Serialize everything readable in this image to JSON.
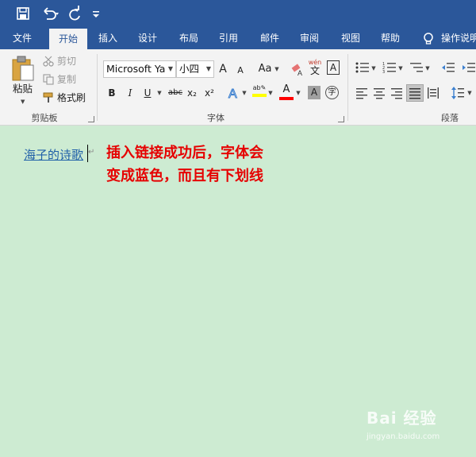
{
  "quick_access": {
    "save_icon": "save-icon",
    "undo_icon": "undo-icon",
    "redo_icon": "redo-icon",
    "customize_icon": "customize-icon"
  },
  "tabs": [
    {
      "label": "文件"
    },
    {
      "label": "开始"
    },
    {
      "label": "插入"
    },
    {
      "label": "设计"
    },
    {
      "label": "布局"
    },
    {
      "label": "引用"
    },
    {
      "label": "邮件"
    },
    {
      "label": "审阅"
    },
    {
      "label": "视图"
    },
    {
      "label": "帮助"
    },
    {
      "label": "操作说明"
    }
  ],
  "active_tab": "开始",
  "clipboard": {
    "paste_label": "粘贴",
    "cut_label": "剪切",
    "copy_label": "复制",
    "format_painter_label": "格式刷",
    "group_label": "剪贴板"
  },
  "font": {
    "font_name": "Microsoft Ya",
    "font_size": "小四",
    "group_label": "字体",
    "bold": "B",
    "italic": "I",
    "underline": "U",
    "strikethrough": "abc",
    "subscript": "x₂",
    "superscript": "x²",
    "grow_font": "A",
    "shrink_font": "A",
    "change_case": "Aa",
    "phonetic": "wén",
    "phonetic_char": "文",
    "char_border": "A",
    "font_color_letter": "A",
    "char_shading": "A",
    "enclose_char": "字"
  },
  "paragraph": {
    "group_label": "段落"
  },
  "document": {
    "link_text": "海子的诗歌",
    "note_line1": "插入链接成功后，字体会",
    "note_line2": "变成蓝色，而且有下划线"
  },
  "colors": {
    "title_blue": "#2b579a",
    "ribbon_bg": "#f3f3f3",
    "page_bg": "#cdebd2",
    "link_color": "#1f5fa8",
    "note_red": "#e60000",
    "highlight_yellow": "#ffff00",
    "font_color_red": "#ff0000"
  },
  "watermark": {
    "brand": "Bai 经验",
    "url": "jingyan.baidu.com"
  }
}
